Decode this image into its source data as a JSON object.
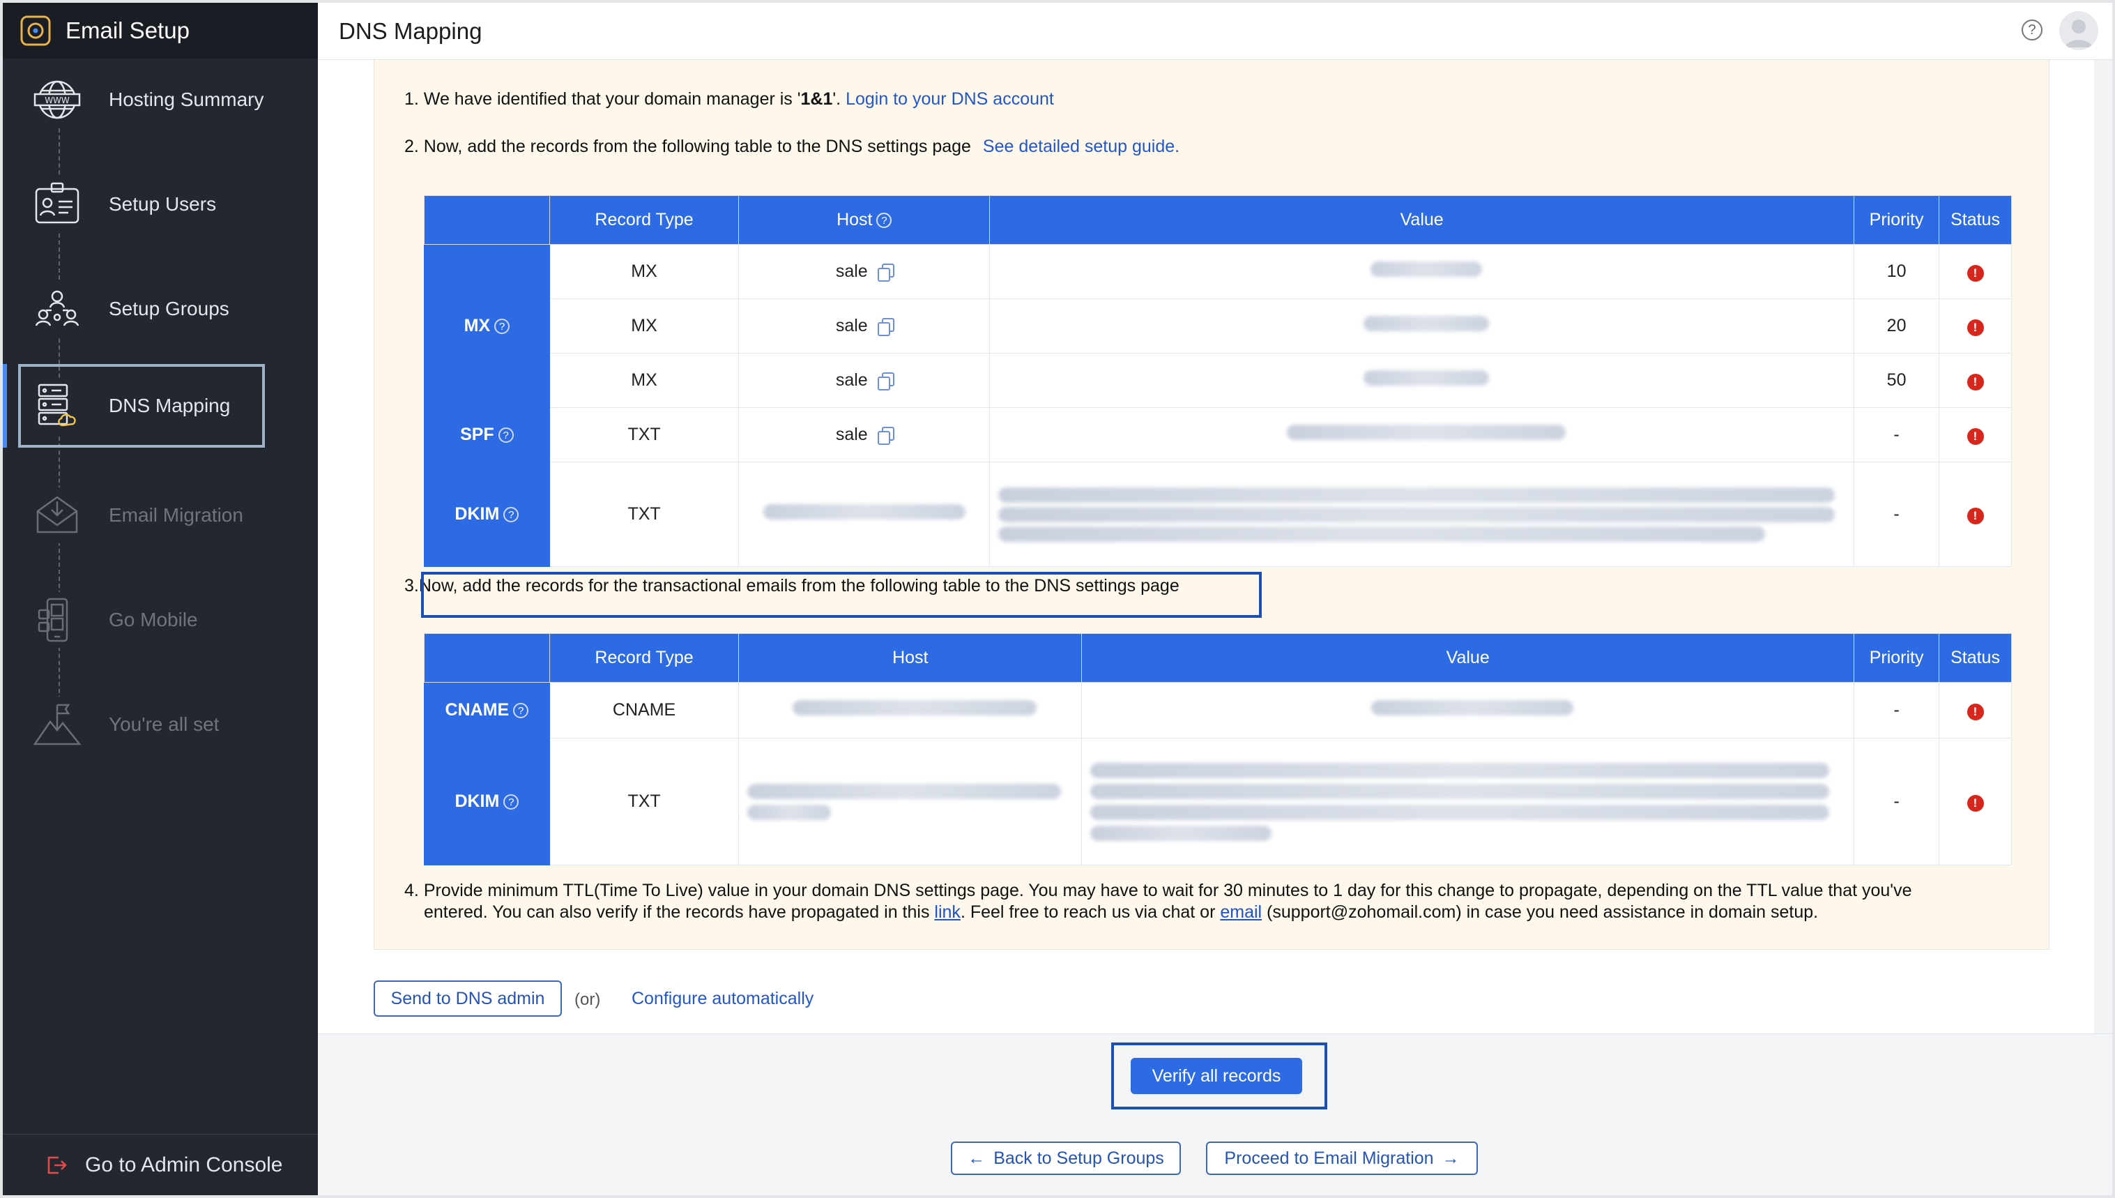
{
  "app": {
    "title": "Email Setup"
  },
  "sidebar": {
    "items": [
      {
        "label": "Hosting Summary",
        "icon": "globe-www-icon",
        "state": "done"
      },
      {
        "label": "Setup Users",
        "icon": "user-card-icon",
        "state": "done"
      },
      {
        "label": "Setup Groups",
        "icon": "group-icon",
        "state": "done"
      },
      {
        "label": "DNS Mapping",
        "icon": "dns-server-icon",
        "state": "active"
      },
      {
        "label": "Email Migration",
        "icon": "envelope-icon",
        "state": "pending"
      },
      {
        "label": "Go Mobile",
        "icon": "mobile-icon",
        "state": "pending"
      },
      {
        "label": "You're all set",
        "icon": "flag-mountain-icon",
        "state": "pending"
      }
    ],
    "footer": {
      "label": "Go to Admin Console",
      "icon": "exit-icon"
    }
  },
  "header": {
    "title": "DNS Mapping"
  },
  "steps": {
    "s1_prefix": "1. We have identified that your domain manager is '",
    "s1_bold": "1&1",
    "s1_suffix": "'.",
    "s1_link": "Login to your DNS account",
    "s2_text": "2. Now, add the records from the following table to the DNS settings page",
    "s2_link": "See detailed setup guide.",
    "s3_num": "3.",
    "s3_text": "Now, add the records for the transactional emails from the following table to the DNS settings page",
    "s4_num": "4.",
    "s4_line1": "Provide minimum TTL(Time To Live) value in your domain DNS settings page. You may have to wait for 30 minutes to 1 day for this change to propagate, depending on the TTL value that you've",
    "s4_line2a": "entered. You can also verify if the records have propagated in this ",
    "s4_link": "link",
    "s4_line2b": ". Feel free to reach us via chat or ",
    "s4_email_link": "email",
    "s4_line2c": " (support@zohomail.com) in case you need assistance in domain setup."
  },
  "table1": {
    "headers": {
      "record_type": "Record Type",
      "host": "Host",
      "value": "Value",
      "priority": "Priority",
      "status": "Status"
    },
    "groups": {
      "mx": "MX",
      "spf": "SPF",
      "dkim": "DKIM"
    },
    "rows": [
      {
        "type": "MX",
        "host": "sale",
        "priority": "10"
      },
      {
        "type": "MX",
        "host": "sale",
        "priority": "20"
      },
      {
        "type": "MX",
        "host": "sale",
        "priority": "50"
      },
      {
        "type": "TXT",
        "host": "sale",
        "priority": "-"
      },
      {
        "type": "TXT",
        "host": "",
        "priority": "-"
      }
    ]
  },
  "table2": {
    "headers": {
      "record_type": "Record Type",
      "host": "Host",
      "value": "Value",
      "priority": "Priority",
      "status": "Status"
    },
    "groups": {
      "cname": "CNAME",
      "dkim": "DKIM"
    },
    "rows": [
      {
        "type": "CNAME",
        "priority": "-"
      },
      {
        "type": "TXT",
        "priority": "-"
      }
    ]
  },
  "actions": {
    "send_dns_admin": "Send to DNS admin",
    "or": "(or)",
    "configure_auto": "Configure automatically",
    "verify": "Verify all records",
    "back": "Back to Setup Groups",
    "proceed": "Proceed to Email Migration"
  },
  "colors": {
    "accent": "#2d6be4",
    "error": "#d9261c",
    "sidebar": "#23272f",
    "panel": "#fef8ec"
  }
}
